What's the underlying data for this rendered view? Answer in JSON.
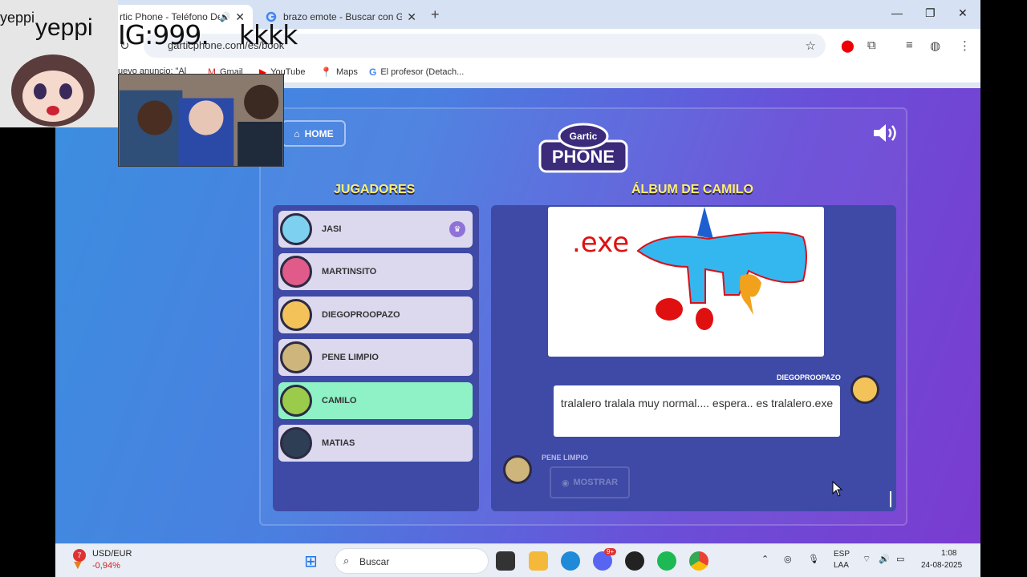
{
  "browser": {
    "tabs": [
      {
        "title": "rtic Phone - Teléfono Des"
      },
      {
        "title": "brazo emote - Buscar con Goo"
      }
    ],
    "url": "garticphone.com/es/book",
    "bookmarks": [
      "uevo anuncio: \"Al",
      "Gmail",
      "YouTube",
      "Maps",
      "El profesor (Detach..."
    ]
  },
  "overlay": {
    "sticker_text_1": "yeppi",
    "sticker_text_2": "yeppi",
    "stream_text": "IG:999.    kkkk"
  },
  "game": {
    "home_label": "HOME",
    "logo_top": "Gartic",
    "logo_bottom": "PHONE",
    "players_heading": "JUGADORES",
    "album_heading": "ÁLBUM DE CAMILO",
    "players": [
      {
        "name": "JASI",
        "host": true
      },
      {
        "name": "MARTINSITO"
      },
      {
        "name": "DIEGOPROOPAZO"
      },
      {
        "name": "PENE LIMPIO"
      },
      {
        "name": "CAMILO",
        "active": true
      },
      {
        "name": "MATIAS"
      }
    ],
    "drawing_text": ".exe",
    "guess_author": "DIEGOPROOPAZO",
    "guess_text": "tralalero tralala muy normal.... espera.. es tralalero.exe",
    "next_author": "PENE LIMPIO",
    "show_label": "MOSTRAR"
  },
  "taskbar": {
    "ticker_symbol": "USD/EUR",
    "ticker_change": "-0,94%",
    "ticker_badge": "7",
    "search_placeholder": "Buscar",
    "discord_badge": "9+",
    "lang_1": "ESP",
    "lang_2": "LAA",
    "time": "1:08",
    "date": "24-08-2025"
  }
}
